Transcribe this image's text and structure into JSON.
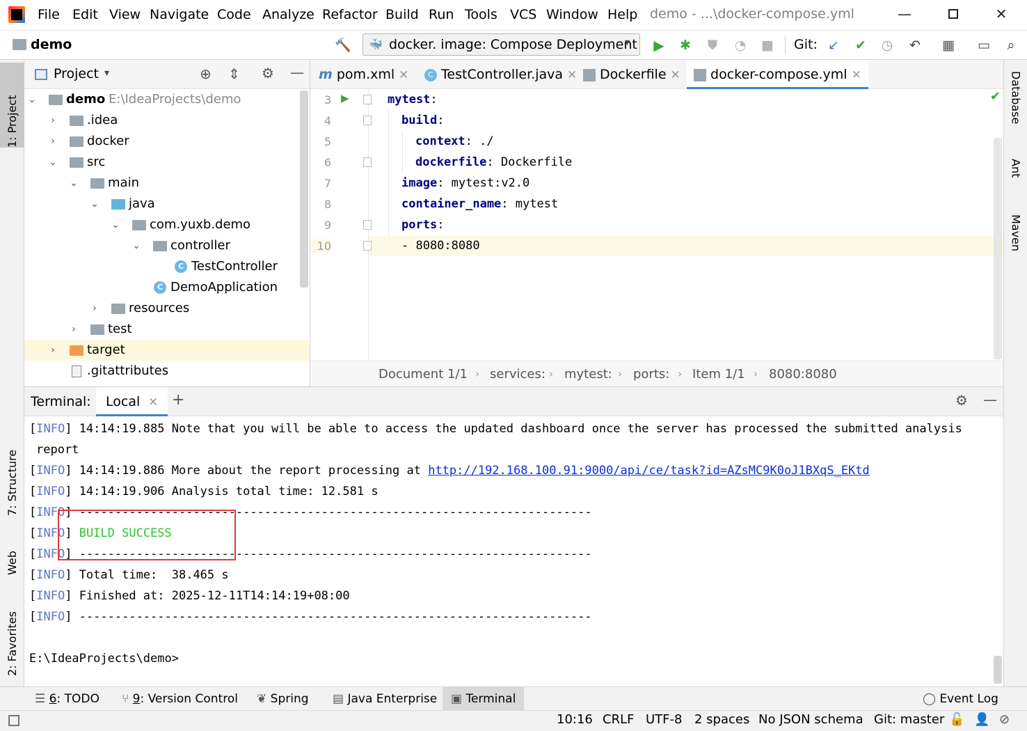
{
  "menubar": {
    "items": [
      "File",
      "Edit",
      "View",
      "Navigate",
      "Code",
      "Analyze",
      "Refactor",
      "Build",
      "Run",
      "Tools",
      "VCS",
      "Window",
      "Help"
    ],
    "title": "demo - ...\\docker-compose.yml"
  },
  "toolbar": {
    "project": "demo",
    "run_config": "docker. image: Compose Deployment",
    "git_label": "Git:"
  },
  "left_strip": {
    "project_tab": "1: Project",
    "structure_tab": "7: Structure",
    "web_tab": "Web",
    "favorites_tab": "2: Favorites"
  },
  "right_strip": {
    "database_tab": "Database",
    "ant_tab": "Ant",
    "maven_tab": "Maven"
  },
  "project_panel": {
    "title": "Project",
    "tree": [
      {
        "label": "demo",
        "path": "E:\\IdeaProjects\\demo"
      },
      {
        "label": ".idea"
      },
      {
        "label": "docker"
      },
      {
        "label": "src"
      },
      {
        "label": "main"
      },
      {
        "label": "java"
      },
      {
        "label": "com.yuxb.demo"
      },
      {
        "label": "controller"
      },
      {
        "label": "TestController"
      },
      {
        "label": "DemoApplication"
      },
      {
        "label": "resources"
      },
      {
        "label": "test"
      },
      {
        "label": "target"
      },
      {
        "label": ".gitattributes"
      }
    ]
  },
  "editor": {
    "tabs": [
      "pom.xml",
      "TestController.java",
      "Dockerfile",
      "docker-compose.yml"
    ],
    "line_numbers": [
      "3",
      "4",
      "5",
      "6",
      "7",
      "8",
      "9",
      "10"
    ],
    "lines": [
      {
        "key": "mytest",
        "value": ""
      },
      {
        "key": "build",
        "value": ""
      },
      {
        "key": "context",
        "value": " ./"
      },
      {
        "key": "dockerfile",
        "value": " Dockerfile"
      },
      {
        "key": "image",
        "value": " mytest:v2.0"
      },
      {
        "key": "container_name",
        "value": " mytest"
      },
      {
        "key": "ports",
        "value": ""
      },
      {
        "key": "",
        "value": "- 8080:8080"
      }
    ],
    "breadcrumbs": [
      "Document 1/1",
      "services:",
      "mytest:",
      "ports:",
      "Item 1/1",
      "8080:8080"
    ]
  },
  "terminal": {
    "label": "Terminal:",
    "tab": "Local",
    "lines": [
      {
        "tag": "INFO",
        "text": " 14:14:19.885 Note that you will be able to access the updated dashboard once the server has processed the submitted analysis"
      },
      {
        "tag": "",
        "text": "report"
      },
      {
        "tag": "INFO",
        "text": " 14:14:19.886 More about the report processing at ",
        "link": "http://192.168.100.91:9000/api/ce/task?id=AZsMC9K0oJ1BXqS_EKtd"
      },
      {
        "tag": "INFO",
        "text": " 14:14:19.906 Analysis total time: 12.581 s"
      },
      {
        "tag": "INFO",
        "text": " ------------------------------------------------------------------------"
      },
      {
        "tag": "INFO",
        "text": " ",
        "success": "BUILD SUCCESS"
      },
      {
        "tag": "INFO",
        "text": " ------------------------------------------------------------------------"
      },
      {
        "tag": "INFO",
        "text": " Total time:  38.465 s"
      },
      {
        "tag": "INFO",
        "text": " Finished at: 2025-12-11T14:14:19+08:00"
      },
      {
        "tag": "INFO",
        "text": " ------------------------------------------------------------------------"
      }
    ],
    "prompt": "E:\\IdeaProjects\\demo>"
  },
  "bottom_tools": [
    {
      "key": "6",
      "label": ": TODO"
    },
    {
      "key": "9",
      "label": ": Version Control"
    },
    {
      "key": "",
      "label": "Spring"
    },
    {
      "key": "",
      "label": "Java Enterprise"
    },
    {
      "key": "",
      "label": "Terminal"
    }
  ],
  "event_log": "Event Log",
  "status": {
    "position": "10:16",
    "line_sep": "CRLF",
    "encoding": "UTF-8",
    "indent": "2 spaces",
    "schema": "No JSON schema",
    "git": "Git: master"
  },
  "colors": {
    "accent": "#4083c9",
    "success": "#33c233",
    "info": "#5d74c7",
    "highlight_box": "#e23b3b"
  }
}
